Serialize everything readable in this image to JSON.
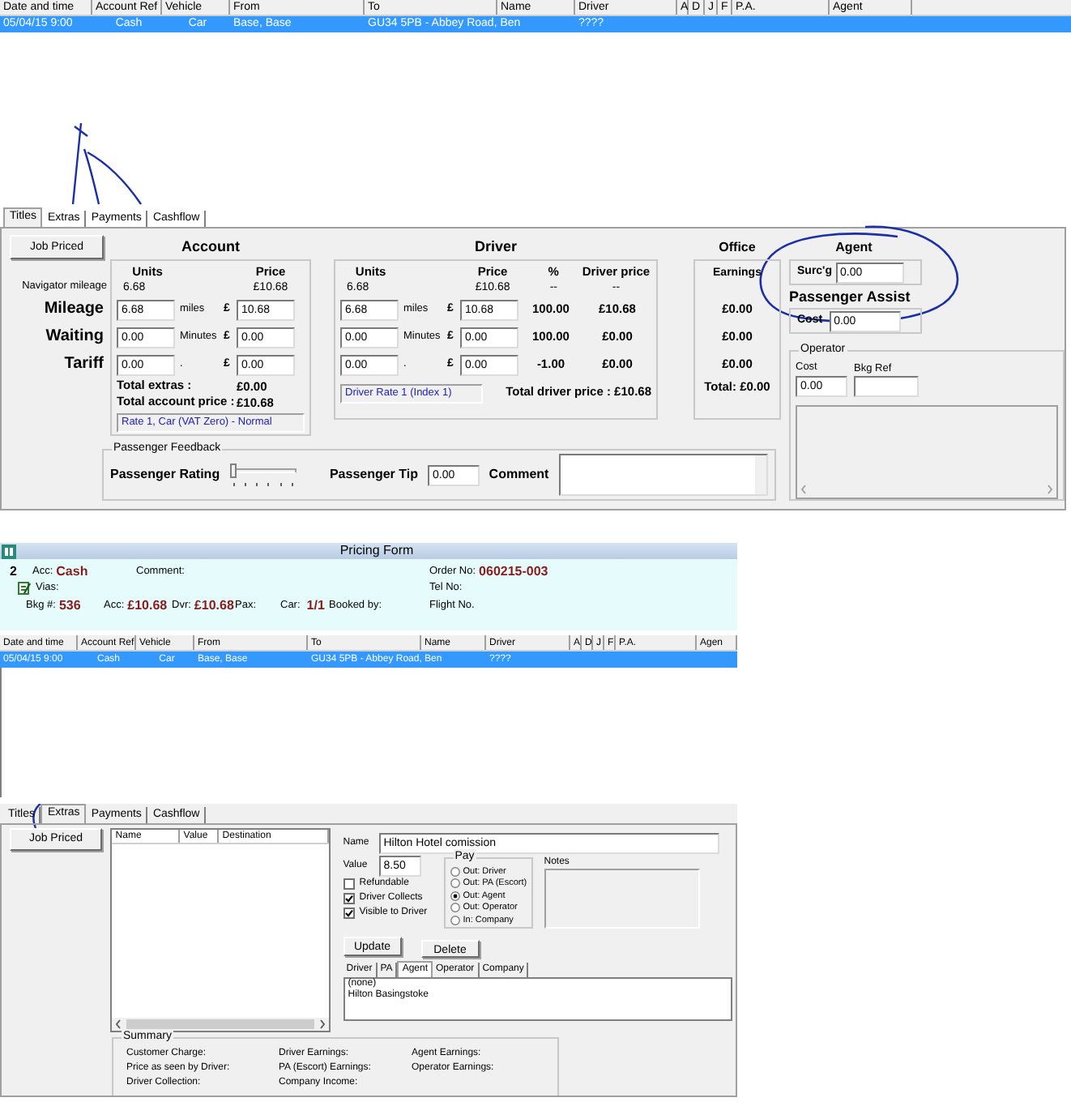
{
  "top_grid": {
    "columns": [
      "Date and time",
      "Account Ref",
      "Vehicle",
      "From",
      "To",
      "Name",
      "Driver",
      "A",
      "D",
      "J",
      "F",
      "P.A.",
      "Agent"
    ],
    "rows": [
      {
        "selected": true,
        "date_and_time": "05/04/15  9:00",
        "account_ref": "Cash",
        "vehicle": "Car",
        "from": "Base, Base",
        "to": "GU34 5PB - Abbey Road, Ben",
        "driver": "????"
      }
    ]
  },
  "pricing_panel": {
    "tabs": [
      {
        "label": "Titles",
        "selected": true
      },
      {
        "label": "Extras",
        "selected": false
      },
      {
        "label": "Payments",
        "selected": false
      },
      {
        "label": "Cashflow",
        "selected": false
      }
    ],
    "job_priced_button": "Job Priced",
    "navigator_label": "Navigator mileage",
    "row_labels": [
      "Mileage",
      "Waiting",
      "Tariff"
    ],
    "account": {
      "title": "Account",
      "units_header": "Units",
      "price_header": "Price",
      "navigator_units": "6.68",
      "navigator_price": "£10.68",
      "rows": [
        {
          "units": "6.68",
          "unit_label": "miles",
          "currency": "£",
          "price": "10.68"
        },
        {
          "units": "0.00",
          "unit_label": "Minutes",
          "currency": "£",
          "price": "0.00"
        },
        {
          "units": "0.00",
          "unit_label": ".",
          "currency": "£",
          "price": "0.00"
        }
      ],
      "total_extras_label": "Total extras :",
      "total_extras": "£0.00",
      "total_label": "Total account price :",
      "total": "£10.68",
      "rate": "Rate 1, Car (VAT Zero) - Normal"
    },
    "driver": {
      "title": "Driver",
      "units_header": "Units",
      "price_header": "Price",
      "percent_header": "%",
      "driver_price_header": "Driver price",
      "navigator_units": "6.68",
      "navigator_price": "£10.68",
      "navigator_percent": "--",
      "navigator_driver_price": "--",
      "rows": [
        {
          "units": "6.68",
          "unit_label": "miles",
          "currency": "£",
          "price": "10.68",
          "percent": "100.00",
          "driver_price": "£10.68"
        },
        {
          "units": "0.00",
          "unit_label": "Minutes",
          "currency": "£",
          "price": "0.00",
          "percent": "100.00",
          "driver_price": "£0.00"
        },
        {
          "units": "0.00",
          "unit_label": ".",
          "currency": "£",
          "price": "0.00",
          "percent": "-1.00",
          "driver_price": "£0.00"
        }
      ],
      "total": "Total driver price : £10.68",
      "rate": "Driver Rate 1 (Index 1)"
    },
    "office": {
      "title": "Office",
      "earnings_header": "Earnings",
      "values": [
        "£0.00",
        "£0.00",
        "£0.00"
      ],
      "total": "Total: £0.00"
    },
    "agent": {
      "title": "Agent",
      "surcharge_label": "Surc'g",
      "surcharge": "0.00"
    },
    "passenger_assist": {
      "title": "Passenger Assist",
      "cost_label": "Cost",
      "cost": "0.00"
    },
    "operator": {
      "title": "Operator",
      "cost_label": "Cost",
      "bkg_ref_label": "Bkg Ref",
      "cost": "0.00"
    },
    "feedback": {
      "title": "Passenger Feedback",
      "rating_label": "Passenger Rating",
      "rating": {
        "level": 0
      },
      "tip_label": "Passenger Tip",
      "tip": "0.00",
      "comment_label": "Comment"
    }
  },
  "pricing_form": {
    "title": "Pricing Form",
    "info": {
      "count": "2",
      "acc_label": "Acc:",
      "acc": "Cash",
      "comment_label": "Comment:",
      "order_label": "Order No:",
      "order": "060215-003",
      "vias_label": "Vias:",
      "tel_label": "Tel No:",
      "bkg_label": "Bkg #:",
      "bkg": "536",
      "acc_price_label": "Acc:",
      "acc_price": "£10.68",
      "dvr_label": "Dvr:",
      "dvr": "£10.68",
      "pax_label": "Pax:",
      "car_label": "Car:",
      "car": "1/1",
      "booked_label": "Booked by:",
      "flight_label": "Flight No."
    },
    "grid": {
      "columns": [
        "Date and time",
        "Account Ref",
        "Vehicle",
        "From",
        "To",
        "Name",
        "Driver",
        "A",
        "D",
        "J",
        "F",
        "P.A.",
        "Agen"
      ],
      "rows": [
        {
          "selected": true,
          "date_and_time": "05/04/15  9:00",
          "account_ref": "Cash",
          "vehicle": "Car",
          "from": "Base, Base",
          "to": "GU34 5PB - Abbey Road, Ben",
          "driver": "????"
        }
      ]
    },
    "tabs": [
      {
        "label": "Titles",
        "selected": false
      },
      {
        "label": "Extras",
        "selected": true
      },
      {
        "label": "Payments",
        "selected": false
      },
      {
        "label": "Cashflow",
        "selected": false
      }
    ],
    "job_priced_button": "Job Priced",
    "extras_columns": [
      "Name",
      "Value",
      "Destination"
    ],
    "name_label": "Name",
    "name": "Hilton Hotel comission",
    "value_label": "Value",
    "value": "8.50",
    "options": [
      {
        "label": "Refundable",
        "checked": false
      },
      {
        "label": "Driver Collects",
        "checked": true
      },
      {
        "label": "Visible to Driver",
        "checked": true
      }
    ],
    "pay": {
      "title": "Pay",
      "options": [
        {
          "label": "Out: Driver",
          "selected": false
        },
        {
          "label": "Out: PA (Escort)",
          "selected": false
        },
        {
          "label": "Out: Agent",
          "selected": true
        },
        {
          "label": "Out: Operator",
          "selected": false
        },
        {
          "label": "In: Company",
          "selected": false
        }
      ]
    },
    "notes_label": "Notes",
    "buttons": [
      "Update",
      "Delete"
    ],
    "recipient_tabs": [
      {
        "label": "Driver",
        "selected": false
      },
      {
        "label": "PA",
        "selected": false
      },
      {
        "label": "Agent",
        "selected": true
      },
      {
        "label": "Operator",
        "selected": false
      },
      {
        "label": "Company",
        "selected": false
      }
    ],
    "recipients": [
      "(none)",
      "Hilton Basingstoke"
    ],
    "summary": {
      "title": "Summary",
      "columns": [
        [
          "Customer Charge:",
          "Price as seen by Driver:",
          "Driver Collection:"
        ],
        [
          "Driver Earnings:",
          "PA (Escort) Earnings:",
          "Company Income:"
        ],
        [
          "Agent Earnings:",
          "Operator Earnings:"
        ]
      ]
    }
  }
}
